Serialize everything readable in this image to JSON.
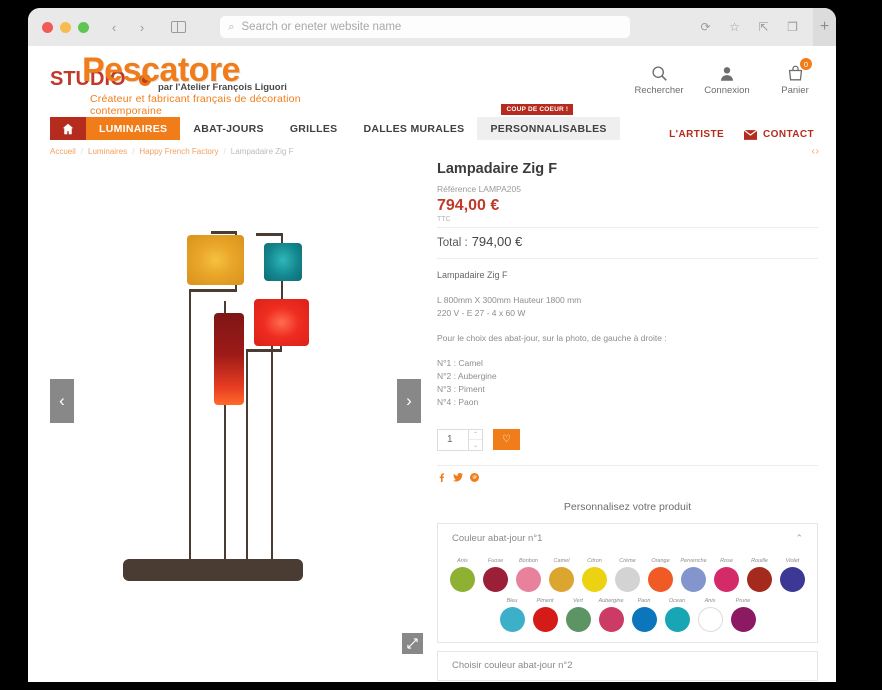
{
  "browser": {
    "back_icon": "‹",
    "forward_icon": "›",
    "sidebar_icon": "sidebar-icon",
    "search_placeholder": "Search or eneter website name",
    "search_icon": "⌕",
    "reload_icon": "⟳",
    "bookmark_icon": "☆",
    "share_icon": "⇱",
    "tabs_icon": "❐",
    "new_tab_icon": "+"
  },
  "site": {
    "logo": {
      "studio": "STUDIO",
      "name": "Pescatore",
      "subtitle": "par l'Atelier François Liguori",
      "tagline": "Créateur et fabricant français de décoration contemporaine"
    },
    "tools": [
      {
        "label": "Rechercher",
        "icon": "search-icon",
        "badge": null
      },
      {
        "label": "Connexion",
        "icon": "user-icon",
        "badge": null
      },
      {
        "label": "Panier",
        "icon": "cart-icon",
        "badge": "0"
      }
    ],
    "nav": {
      "home_icon": "home-icon",
      "items": [
        {
          "label": "LUMINAIRES",
          "state": "active"
        },
        {
          "label": "ABAT-JOURS",
          "state": "default"
        },
        {
          "label": "GRILLES",
          "state": "default"
        },
        {
          "label": "DALLES MURALES",
          "state": "default"
        },
        {
          "label": "PERSONNALISABLES",
          "state": "grey",
          "badge": "COUP DE COEUR !"
        }
      ],
      "right": [
        {
          "label": "L'ARTISTE",
          "icon": null
        },
        {
          "label": "CONTACT",
          "icon": "mail-icon"
        }
      ]
    }
  },
  "breadcrumb": {
    "items": [
      "Accueil",
      "Luminaires",
      "Happy French Factory",
      "Lampadaire Zig F"
    ],
    "separator": "/",
    "prev_next": "‹ ›"
  },
  "gallery": {
    "prev_icon": "‹",
    "next_icon": "›",
    "expand_icon": "⤢",
    "alt": "Lampadaire Zig F - floor lamp with four coloured shades"
  },
  "product": {
    "title": "Lampadaire Zig F",
    "reference": "Référence LAMPA205",
    "price": "794,00 €",
    "price_note": "TTC",
    "total_label": "Total :",
    "total_value": "794,00 €",
    "description": {
      "heading": "Lampadaire Zig F",
      "dimensions": "L 800mm X 300mm Hauteur 1800 mm",
      "electrical": "220 V - E 27 - 4 x 60 W",
      "intro": "Pour le choix des abat-jour, sur la photo, de gauche à droite :",
      "shades": [
        "N°1 : Camel",
        "N°2 : Aubergine",
        "N°3 : Piment",
        "N°4 : Paon"
      ]
    },
    "quantity": "1",
    "qty_up_icon": "⌃",
    "qty_down_icon": "⌄",
    "wishlist_icon": "♡",
    "socials": [
      {
        "name": "facebook-icon",
        "glyph": "f"
      },
      {
        "name": "twitter-icon",
        "glyph": "🐦"
      },
      {
        "name": "pinterest-icon",
        "glyph": "P"
      }
    ]
  },
  "customize": {
    "title": "Personnalisez votre produit",
    "accordion1": {
      "label": "Couleur abat-jour n°1",
      "chevron": "⌃",
      "row1": [
        {
          "label": "Anis",
          "color": "#8fb133"
        },
        {
          "label": "Fuose",
          "color": "#9b1f36"
        },
        {
          "label": "Bonbon",
          "color": "#e8819c"
        },
        {
          "label": "Camel",
          "color": "#dba52f"
        },
        {
          "label": "Citron",
          "color": "#ecd211"
        },
        {
          "label": "Crème",
          "color": "#d3d3d3"
        },
        {
          "label": "Orange",
          "color": "#f05a24"
        },
        {
          "label": "Pervenche",
          "color": "#8395cc"
        },
        {
          "label": "Rose",
          "color": "#d42a67"
        },
        {
          "label": "Rouille",
          "color": "#a32a1d"
        },
        {
          "label": "Violet",
          "color": "#3b3896"
        }
      ],
      "row2": [
        {
          "label": "Bleu",
          "color": "#3cb0c9"
        },
        {
          "label": "Piment",
          "color": "#d41b18"
        },
        {
          "label": "Vert",
          "color": "#5d9464"
        },
        {
          "label": "Aubergine",
          "color": "#cc3b63"
        },
        {
          "label": "Paon",
          "color": "#0b76bb"
        },
        {
          "label": "Ocean",
          "color": "#18a6b5"
        },
        {
          "label": "Anis",
          "color": "#ffffff"
        },
        {
          "label": "Prune",
          "color": "#8b1a62"
        }
      ]
    },
    "accordion2": {
      "label": "Choisir couleur abat-jour n°2"
    }
  }
}
